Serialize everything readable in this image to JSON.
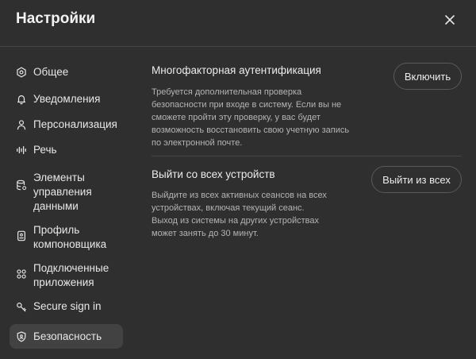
{
  "header": {
    "title": "Настройки",
    "close_icon": "close-icon"
  },
  "sidebar": {
    "items": [
      {
        "label": "Общее",
        "icon": "gear-icon"
      },
      {
        "label": "Уведомления",
        "icon": "bell-icon"
      },
      {
        "label": "Персонализация",
        "icon": "user-icon"
      },
      {
        "label": "Речь",
        "icon": "waveform-icon"
      },
      {
        "label": "Элементы управления данными",
        "icon": "database-icon"
      },
      {
        "label": "Профиль компоновщика",
        "icon": "id-card-icon"
      },
      {
        "label": "Подключенные приложения",
        "icon": "apps-grid-icon"
      },
      {
        "label": "Secure sign in",
        "icon": "key-icon"
      },
      {
        "label": "Безопасность",
        "icon": "shield-icon",
        "active": true
      }
    ]
  },
  "security": {
    "mfa": {
      "title": "Многофакторная аутентификация",
      "description": "Требуется дополнительная проверка\nбезопасности при входе в систему. Если вы не\nсможете пройти эту проверку, у вас будет\nвозможность восстановить свою учетную запись\nпо электронной почте.",
      "button_label": "Включить"
    },
    "logout_all": {
      "title": "Выйти со всех устройств",
      "description": "Выйдите из всех активных сеансов на всех\nустройствах, включая текущий сеанс.\nВыход из системы на других устройствах\nможет занять до 30 минут.",
      "button_label": "Выйти из всех"
    }
  }
}
